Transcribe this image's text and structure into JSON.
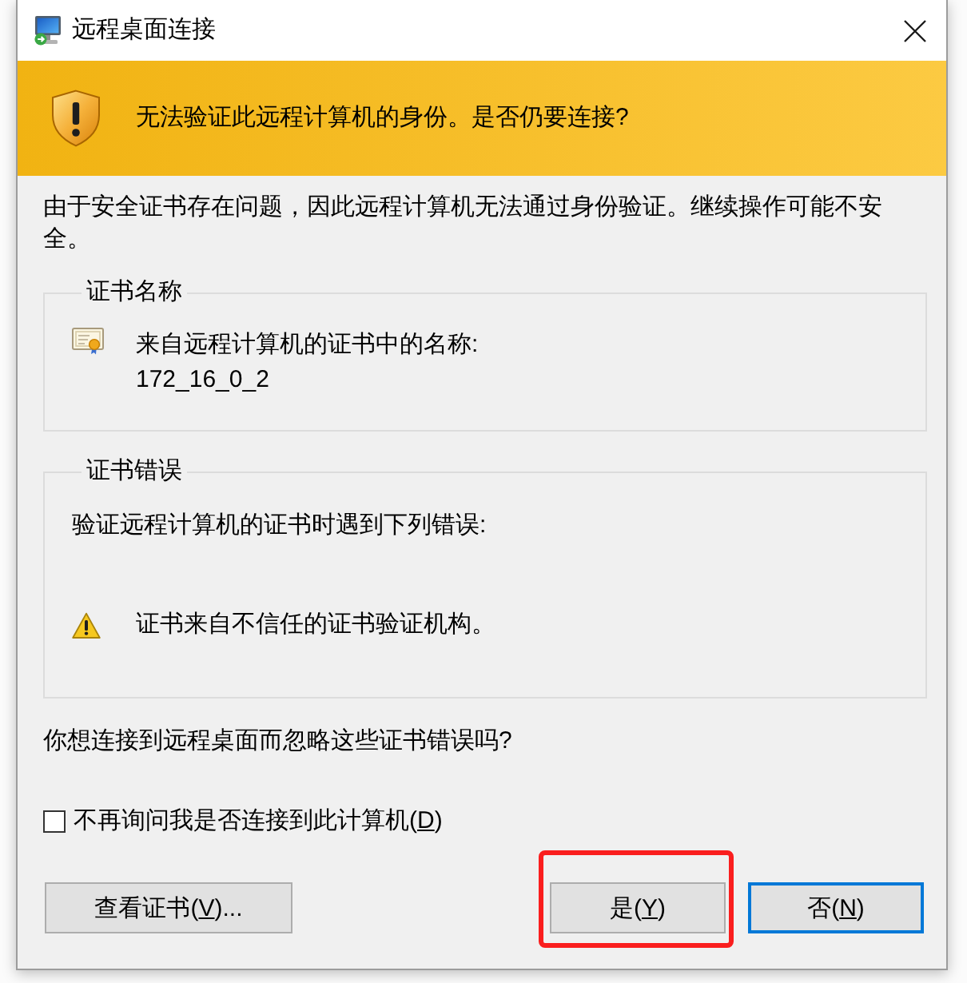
{
  "window": {
    "title": "远程桌面连接"
  },
  "banner": {
    "message": "无法验证此远程计算机的身份。是否仍要连接?"
  },
  "description": "由于安全证书存在问题，因此远程计算机无法通过身份验证。继续操作可能不安全。",
  "certificate_name": {
    "heading": "证书名称",
    "label": "来自远程计算机的证书中的名称:",
    "value": "172_16_0_2"
  },
  "certificate_errors": {
    "heading": "证书错误",
    "intro": "验证远程计算机的证书时遇到下列错误:",
    "errors": [
      {
        "kind": "warning",
        "text": "证书来自不信任的证书验证机构。"
      }
    ]
  },
  "question": "你想连接到远程桌面而忽略这些证书错误吗?",
  "dont_ask_checkbox": {
    "label": "不再询问我是否连接到此计算机(",
    "access_key": "D",
    "label_end": ")",
    "checked": false
  },
  "view_certificate_button": {
    "label": "查看证书(",
    "access_key": "V",
    "label_end": ")..."
  },
  "buttons": [
    {
      "label": "是(",
      "access_key": "Y",
      "label_end": ")",
      "default": false,
      "highlighted": true
    },
    {
      "label": "否(",
      "access_key": "N",
      "label_end": ")",
      "default": true,
      "highlighted": false
    }
  ]
}
